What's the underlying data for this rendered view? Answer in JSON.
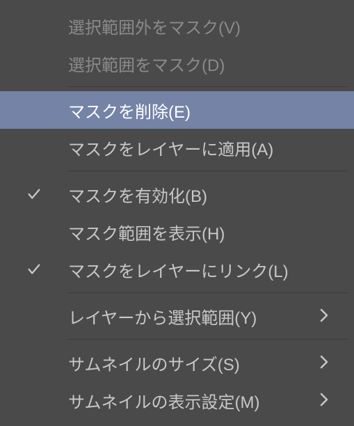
{
  "menu": {
    "items": [
      {
        "label": "選択範囲外をマスク(V)",
        "disabled": true,
        "selected": false,
        "checked": false,
        "submenu": false
      },
      {
        "label": "選択範囲をマスク(D)",
        "disabled": true,
        "selected": false,
        "checked": false,
        "submenu": false
      },
      {
        "separator": true
      },
      {
        "label": "マスクを削除(E)",
        "disabled": false,
        "selected": true,
        "checked": false,
        "submenu": false
      },
      {
        "label": "マスクをレイヤーに適用(A)",
        "disabled": false,
        "selected": false,
        "checked": false,
        "submenu": false
      },
      {
        "separator": true
      },
      {
        "label": "マスクを有効化(B)",
        "disabled": false,
        "selected": false,
        "checked": true,
        "submenu": false
      },
      {
        "label": "マスク範囲を表示(H)",
        "disabled": false,
        "selected": false,
        "checked": false,
        "submenu": false
      },
      {
        "label": "マスクをレイヤーにリンク(L)",
        "disabled": false,
        "selected": false,
        "checked": true,
        "submenu": false
      },
      {
        "separator": true
      },
      {
        "label": "レイヤーから選択範囲(Y)",
        "disabled": false,
        "selected": false,
        "checked": false,
        "submenu": true
      },
      {
        "separator": true
      },
      {
        "label": "サムネイルのサイズ(S)",
        "disabled": false,
        "selected": false,
        "checked": false,
        "submenu": true
      },
      {
        "label": "サムネイルの表示設定(M)",
        "disabled": false,
        "selected": false,
        "checked": false,
        "submenu": true
      }
    ]
  },
  "colors": {
    "bg": "#4a4a4a",
    "text": "#c8c8c8",
    "disabled": "#8a8a8a",
    "selected_bg": "#7483a6",
    "selected_text": "#ffffff",
    "separator": "#3a3a3a"
  }
}
